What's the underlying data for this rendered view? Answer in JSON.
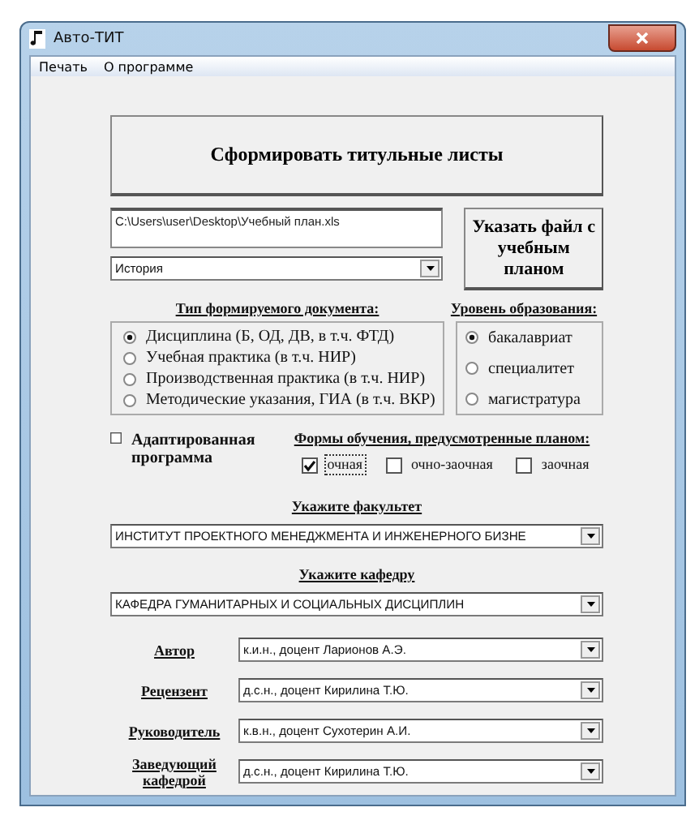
{
  "window": {
    "title": "Авто-ТИТ"
  },
  "menu": [
    "Печать",
    "О программе"
  ],
  "generate_button": "Сформировать титульные листы",
  "file_path": {
    "value": "C:\\Users\\user\\Desktop\\Учебный план.xls"
  },
  "choose_file_button": "Указать файл с учебным планом",
  "discipline": {
    "value": "История"
  },
  "document_type": {
    "label": "Тип формируемого документа:",
    "options": [
      {
        "label": "Дисциплина (Б, ОД, ДВ, в т.ч. ФТД)",
        "selected": true
      },
      {
        "label": "Учебная практика (в т.ч. НИР)",
        "selected": false
      },
      {
        "label": "Производственная практика (в т.ч. НИР)",
        "selected": false
      },
      {
        "label": "Методические указания, ГИА (в т.ч. ВКР)",
        "selected": false
      }
    ]
  },
  "education_level": {
    "label": "Уровень образования:",
    "options": [
      {
        "label": "бакалавриат",
        "selected": true
      },
      {
        "label": "специалитет",
        "selected": false
      },
      {
        "label": "магистратура",
        "selected": false
      }
    ]
  },
  "adapted_program": {
    "label": "Адаптированная программа",
    "checked": false
  },
  "study_forms": {
    "label": "Формы обучения, предусмотренные планом:",
    "options": [
      {
        "label": "очная",
        "checked": true,
        "focused": true
      },
      {
        "label": "очно-заочная",
        "checked": false,
        "focused": false
      },
      {
        "label": "заочная",
        "checked": false,
        "focused": false
      }
    ]
  },
  "faculty": {
    "label": "Укажите факультет",
    "value": "ИНСТИТУТ ПРОЕКТНОГО МЕНЕДЖМЕНТА И ИНЖЕНЕРНОГО БИЗНЕ"
  },
  "department": {
    "label": "Укажите кафедру",
    "value": "КАФЕДРА ГУМАНИТАРНЫХ И СОЦИАЛЬНЫХ ДИСЦИПЛИН"
  },
  "people": [
    {
      "label": "Автор",
      "value": "к.и.н., доцент Ларионов А.Э."
    },
    {
      "label": "Рецензент",
      "value": "д.с.н., доцент Кирилина Т.Ю."
    },
    {
      "label": "Руководитель",
      "value": "к.в.н., доцент Сухотерин А.И."
    },
    {
      "label": "Заведующий кафедрой",
      "value": "д.с.н., доцент Кирилина Т.Ю."
    }
  ]
}
